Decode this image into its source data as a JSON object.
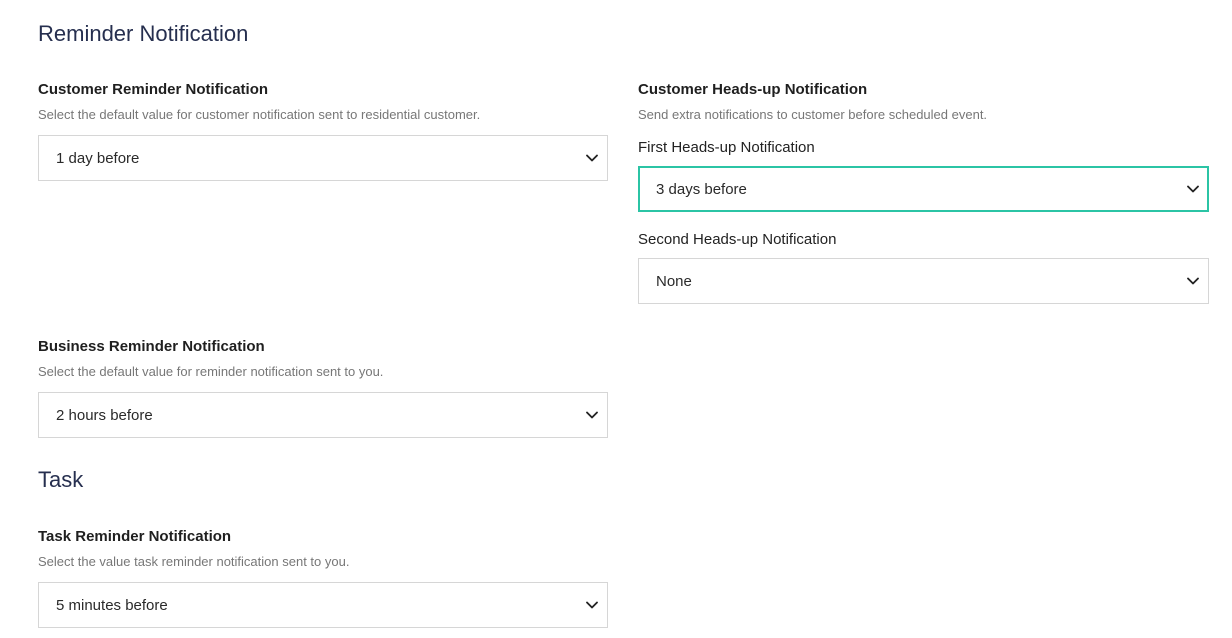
{
  "reminder_section": {
    "title": "Reminder Notification"
  },
  "customer_reminder": {
    "title": "Customer Reminder Notification",
    "description": "Select the default value for customer notification sent to residential customer.",
    "selected": "1 day before"
  },
  "customer_headsup": {
    "title": "Customer Heads-up Notification",
    "description": "Send extra notifications to customer before scheduled event.",
    "first": {
      "label": "First Heads-up Notification",
      "selected": "3 days before"
    },
    "second": {
      "label": "Second Heads-up Notification",
      "selected": "None"
    }
  },
  "business_reminder": {
    "title": "Business Reminder Notification",
    "description": "Select the default value for reminder notification sent to you.",
    "selected": "2 hours before"
  },
  "task_section": {
    "title": "Task"
  },
  "task_reminder": {
    "title": "Task Reminder Notification",
    "description": "Select the value task reminder notification sent to you.",
    "selected": "5 minutes before"
  },
  "colors": {
    "section_title": "#262f4f",
    "focus_border": "#2bc4a5",
    "select_border": "#d6d6d6",
    "description": "#777777"
  },
  "icons": {
    "select_indicator": "chevron-down-icon"
  }
}
